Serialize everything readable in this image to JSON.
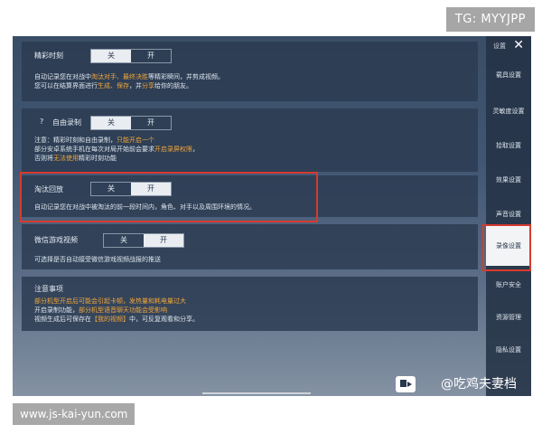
{
  "overlay": {
    "tg": "TG: MYYJPP",
    "site": "www.js-kai-yun.com",
    "weibo": "@吃鸡夫妻档"
  },
  "topbar": {
    "label": "设置",
    "close_icon": "close-icon"
  },
  "sections": {
    "highlight": {
      "title": "精彩时刻",
      "off": "关",
      "on": "开",
      "selected": "关",
      "desc_1_pre": "自动记录您在对战中",
      "desc_1_h1": "淘汰对手、最终决胜",
      "desc_1_post": "等精彩瞬间，并剪成视频。",
      "desc_2_pre": "您可以在结算界面进行",
      "desc_2_h1": "生成、保存",
      "desc_2_mid": "，并",
      "desc_2_h2": "分享",
      "desc_2_post": "给你的朋友。"
    },
    "freerec": {
      "question": "?",
      "title": "自由录制",
      "off": "关",
      "on": "开",
      "selected": "关",
      "desc_1_pre": "注意：精彩时刻和自由录制，",
      "desc_1_h": "只能开启一个",
      "desc_2_pre": "部分安卓系统手机在每次对局开始前会要求",
      "desc_2_h": "开启录屏权限",
      "desc_2_post": "，",
      "desc_3_pre": "否则将",
      "desc_3_h": "无法使用",
      "desc_3_post": "精彩时刻功能"
    },
    "replay": {
      "title": "淘汰回放",
      "off": "关",
      "on": "开",
      "selected": "开",
      "desc": "自动记录您在对战中被淘汰的前一段时间内，角色、对手以及周围环境的情况。"
    },
    "wechat": {
      "title": "微信游戏视频",
      "off": "关",
      "on": "开",
      "selected": "开",
      "desc": "可选择是否自动接受微信游戏视频战报的推送"
    },
    "notice": {
      "title": "注意事项",
      "line_1": "部分机型开启后可能会引起卡顿，发热量和耗电量过大",
      "line_2_pre": "开启录制功能，",
      "line_2_h": "部分机型语音聊天功能会受影响",
      "line_3_pre": "视频生成后可保存在",
      "line_3_h": "【我的视频】",
      "line_3_post": "中，可反复观看和分享。"
    }
  },
  "sidebar": {
    "items": [
      {
        "label": "载具设置"
      },
      {
        "label": "灵敏度设置"
      },
      {
        "label": "拾取设置"
      },
      {
        "label": "效果设置"
      },
      {
        "label": "声音设置"
      },
      {
        "label": "录像设置"
      },
      {
        "label": "账户安全"
      },
      {
        "label": "资源管理"
      },
      {
        "label": "隐私设置"
      }
    ],
    "active": "录像设置"
  },
  "colors": {
    "accent_orange": "#f0a53a",
    "highlight_red": "#d63a2e",
    "panel_bg": "#2b3b50"
  }
}
